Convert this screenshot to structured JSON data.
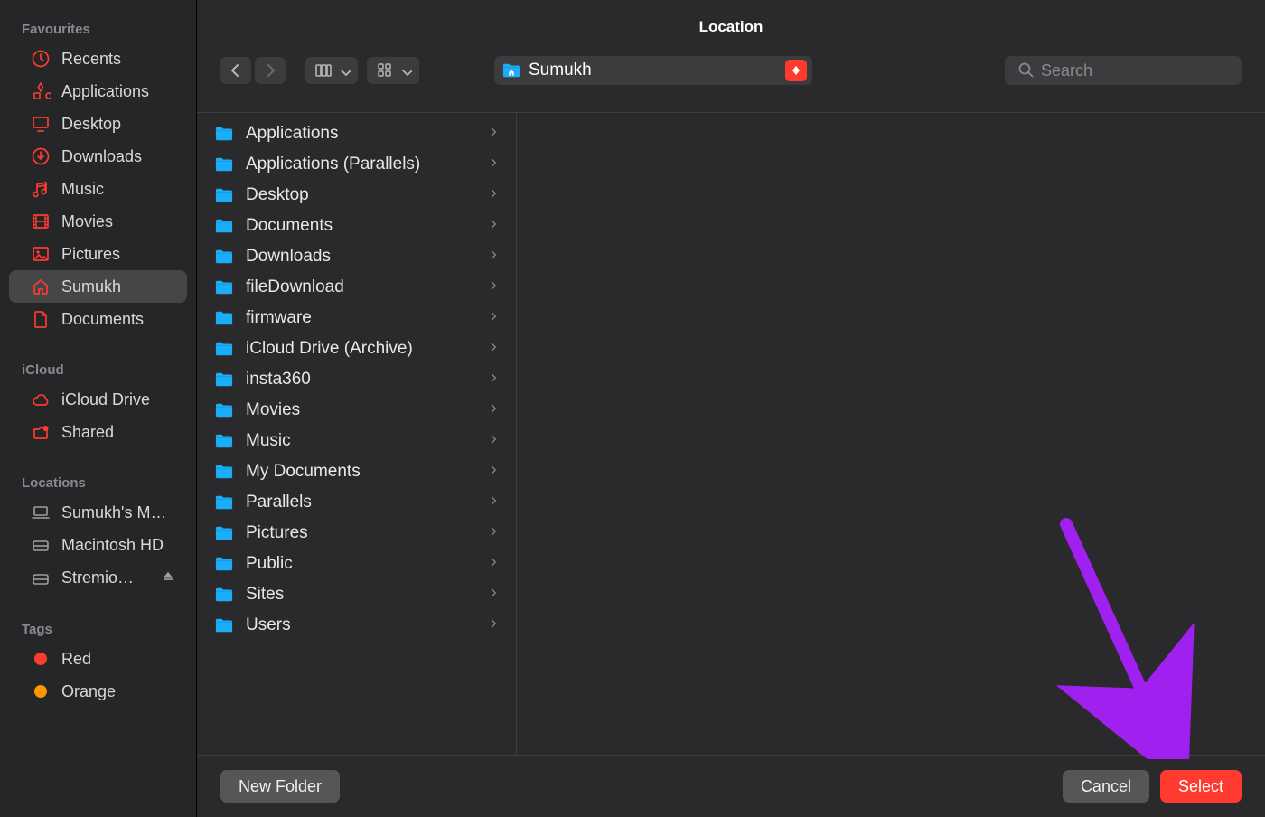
{
  "title": "Location",
  "toolbar": {
    "path_label": "Sumukh",
    "search_placeholder": "Search"
  },
  "sidebar": {
    "sections": [
      {
        "title": "Favourites",
        "items": [
          {
            "icon": "clock",
            "label": "Recents"
          },
          {
            "icon": "apps",
            "label": "Applications"
          },
          {
            "icon": "desktop",
            "label": "Desktop"
          },
          {
            "icon": "download",
            "label": "Downloads"
          },
          {
            "icon": "music",
            "label": "Music"
          },
          {
            "icon": "movies",
            "label": "Movies"
          },
          {
            "icon": "pictures",
            "label": "Pictures"
          },
          {
            "icon": "home",
            "label": "Sumukh",
            "selected": true
          },
          {
            "icon": "document",
            "label": "Documents"
          }
        ]
      },
      {
        "title": "iCloud",
        "items": [
          {
            "icon": "cloud",
            "label": "iCloud Drive"
          },
          {
            "icon": "shared",
            "label": "Shared"
          }
        ]
      },
      {
        "title": "Locations",
        "items": [
          {
            "icon": "laptop",
            "label": "Sumukh's M…"
          },
          {
            "icon": "disk",
            "label": "Macintosh HD"
          },
          {
            "icon": "disk",
            "label": "Stremio…",
            "eject": true
          }
        ]
      },
      {
        "title": "Tags",
        "items": [
          {
            "icon": "tag",
            "label": "Red",
            "color": "#ff3b30"
          },
          {
            "icon": "tag",
            "label": "Orange",
            "color": "#ff9500"
          }
        ]
      }
    ]
  },
  "folders": [
    {
      "name": "Applications",
      "glyph": "apps"
    },
    {
      "name": "Applications (Parallels)",
      "glyph": "window"
    },
    {
      "name": "Desktop",
      "glyph": "plain"
    },
    {
      "name": "Documents",
      "glyph": "plain"
    },
    {
      "name": "Downloads",
      "glyph": "plain"
    },
    {
      "name": "fileDownload",
      "glyph": "plain"
    },
    {
      "name": "firmware",
      "glyph": "plain"
    },
    {
      "name": "iCloud Drive (Archive)",
      "glyph": "plain"
    },
    {
      "name": "insta360",
      "glyph": "plain"
    },
    {
      "name": "Movies",
      "glyph": "movies"
    },
    {
      "name": "Music",
      "glyph": "music"
    },
    {
      "name": "My Documents",
      "glyph": "plain"
    },
    {
      "name": "Parallels",
      "glyph": "plain"
    },
    {
      "name": "Pictures",
      "glyph": "pictures"
    },
    {
      "name": "Public",
      "glyph": "public"
    },
    {
      "name": "Sites",
      "glyph": "plain"
    },
    {
      "name": "Users",
      "glyph": "plain"
    }
  ],
  "footer": {
    "new_folder": "New Folder",
    "cancel": "Cancel",
    "select": "Select"
  },
  "colors": {
    "accent": "#ff3b30",
    "folder": "#1badf8"
  }
}
